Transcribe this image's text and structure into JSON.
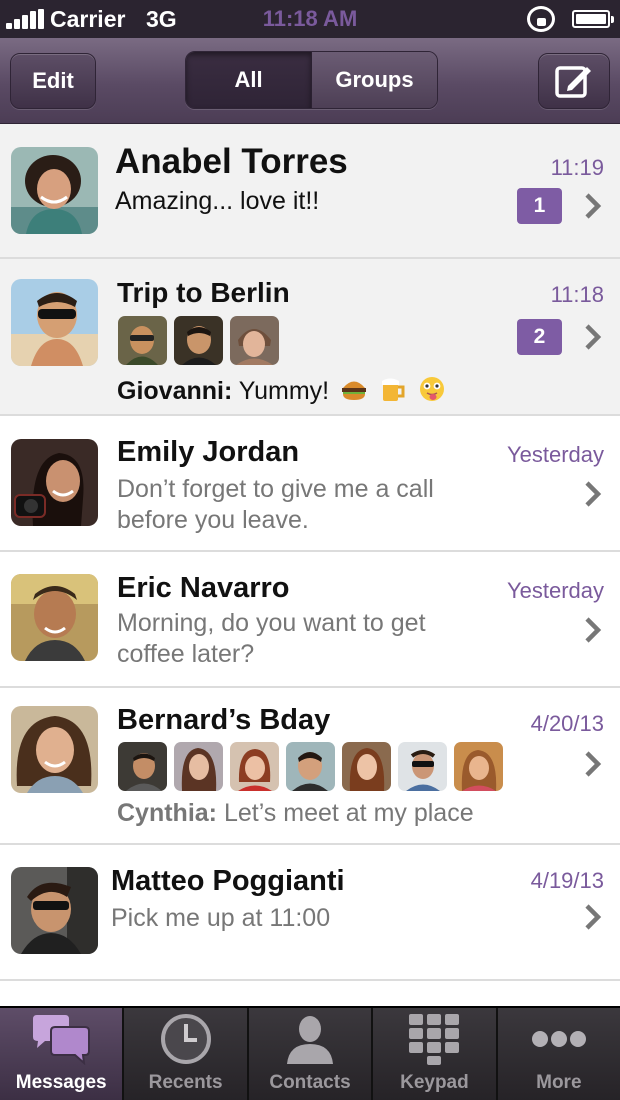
{
  "status_bar": {
    "carrier": "Carrier",
    "network": "3G",
    "time": "11:18 AM",
    "icons": [
      "signal-bars-icon",
      "orientation-lock-icon",
      "battery-icon"
    ]
  },
  "nav": {
    "edit_label": "Edit",
    "segments": [
      "All",
      "Groups"
    ],
    "selected_segment": "All",
    "compose_icon": "compose-icon"
  },
  "colors": {
    "accent": "#7e5ca4",
    "nav_bar": "#5a4a64",
    "unread_row_bg": "#f2f2f2",
    "timestamp": "#7a5a9c"
  },
  "conversations": [
    {
      "name": "Anabel Torres",
      "preview": "Amazing... love it!!",
      "time": "11:19",
      "badge": "1",
      "unread": true
    },
    {
      "name": "Trip to Berlin",
      "sender": "Giovanni:",
      "preview": " Yummy!",
      "emojis": [
        "burger-emoji",
        "beer-mug-emoji",
        "tongue-out-emoji"
      ],
      "time": "11:18",
      "badge": "2",
      "unread": true,
      "group": true,
      "member_count": 3
    },
    {
      "name": "Emily Jordan",
      "preview_line1": "Don’t forget to give me a call",
      "preview_line2": "before you leave.",
      "time": "Yesterday"
    },
    {
      "name": "Eric Navarro",
      "preview_line1": "Morning, do you want to get",
      "preview_line2": "coffee later?",
      "time": "Yesterday"
    },
    {
      "name": "Bernard’s Bday",
      "sender": "Cynthia:",
      "preview": " Let’s meet at my place",
      "time": "4/20/13",
      "group": true,
      "member_count": 7
    },
    {
      "name": "Matteo Poggianti",
      "preview": "Pick me up at 11:00",
      "time": "4/19/13"
    }
  ],
  "tabs": [
    {
      "label": "Messages",
      "icon": "chat-bubbles-icon",
      "active": true
    },
    {
      "label": "Recents",
      "icon": "clock-icon"
    },
    {
      "label": "Contacts",
      "icon": "person-icon"
    },
    {
      "label": "Keypad",
      "icon": "keypad-icon"
    },
    {
      "label": "More",
      "icon": "more-dots-icon"
    }
  ]
}
